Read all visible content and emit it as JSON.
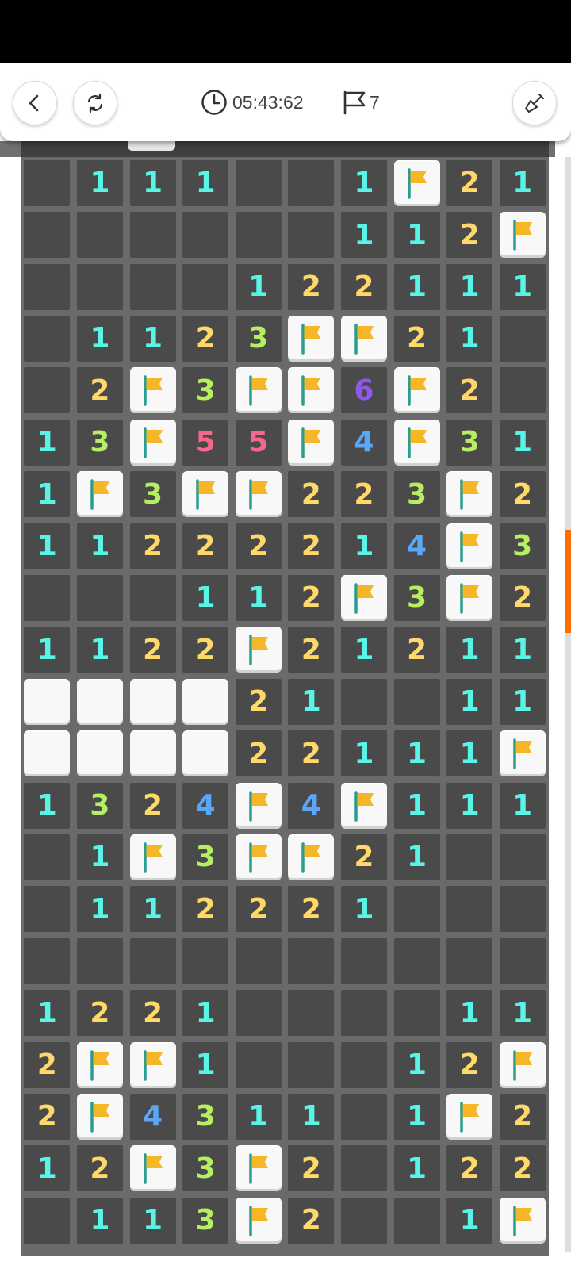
{
  "toolbar": {
    "timer": "05:43:62",
    "flags_left": "7",
    "icons": {
      "back": "chevron-left-icon",
      "restart": "restart-icon",
      "clock": "clock-icon",
      "flag": "flag-icon",
      "tool": "shovel-icon"
    }
  },
  "colors": {
    "n1": "#58f5e6",
    "n2": "#ffd86a",
    "n3": "#b7ef62",
    "n4": "#5aa7f7",
    "n5": "#f7668d",
    "n6": "#9157f0",
    "flag": "#f5b728",
    "hidden_tile": "#f8f8f8",
    "revealed_cell": "#4a4a4a",
    "scroll_thumb": "#ff6d00"
  },
  "board": {
    "legend": "digit = revealed count, F = flag, H = unrevealed tile, . = empty revealed",
    "rows": [
      [
        ".",
        "1",
        "1",
        "1",
        ".",
        ".",
        "1",
        "F",
        "2",
        "1"
      ],
      [
        ".",
        ".",
        ".",
        ".",
        ".",
        ".",
        "1",
        "1",
        "2",
        "F"
      ],
      [
        ".",
        ".",
        ".",
        ".",
        "1",
        "2",
        "2",
        "1",
        "1",
        "1"
      ],
      [
        ".",
        "1",
        "1",
        "2",
        "3",
        "F",
        "F",
        "2",
        "1",
        "."
      ],
      [
        ".",
        "2",
        "F",
        "3",
        "F",
        "F",
        "6",
        "F",
        "2",
        "."
      ],
      [
        "1",
        "3",
        "F",
        "5",
        "5",
        "F",
        "4",
        "F",
        "3",
        "1"
      ],
      [
        "1",
        "F",
        "3",
        "F",
        "F",
        "2",
        "2",
        "3",
        "F",
        "2"
      ],
      [
        "1",
        "1",
        "2",
        "2",
        "2",
        "2",
        "1",
        "4",
        "F",
        "3"
      ],
      [
        ".",
        ".",
        ".",
        "1",
        "1",
        "2",
        "F",
        "3",
        "F",
        "2"
      ],
      [
        "1",
        "1",
        "2",
        "2",
        "F",
        "2",
        "1",
        "2",
        "1",
        "1"
      ],
      [
        "H",
        "H",
        "H",
        "H",
        "2",
        "1",
        ".",
        ".",
        "1",
        "1"
      ],
      [
        "H",
        "H",
        "H",
        "H",
        "2",
        "2",
        "1",
        "1",
        "1",
        "F"
      ],
      [
        "1",
        "3",
        "2",
        "4",
        "F",
        "4",
        "F",
        "1",
        "1",
        "1"
      ],
      [
        ".",
        "1",
        "F",
        "3",
        "F",
        "F",
        "2",
        "1",
        ".",
        "."
      ],
      [
        ".",
        "1",
        "1",
        "2",
        "2",
        "2",
        "1",
        ".",
        ".",
        "."
      ],
      [
        ".",
        ".",
        ".",
        ".",
        ".",
        ".",
        ".",
        ".",
        ".",
        "."
      ],
      [
        "1",
        "2",
        "2",
        "1",
        ".",
        ".",
        ".",
        ".",
        "1",
        "1"
      ],
      [
        "2",
        "F",
        "F",
        "1",
        ".",
        ".",
        ".",
        "1",
        "2",
        "F"
      ],
      [
        "2",
        "F",
        "4",
        "3",
        "1",
        "1",
        ".",
        "1",
        "F",
        "2"
      ],
      [
        "1",
        "2",
        "F",
        "3",
        "F",
        "2",
        ".",
        "1",
        "2",
        "2"
      ],
      [
        ".",
        "1",
        "1",
        "3",
        "F",
        "2",
        ".",
        ".",
        "1",
        "F"
      ]
    ]
  }
}
